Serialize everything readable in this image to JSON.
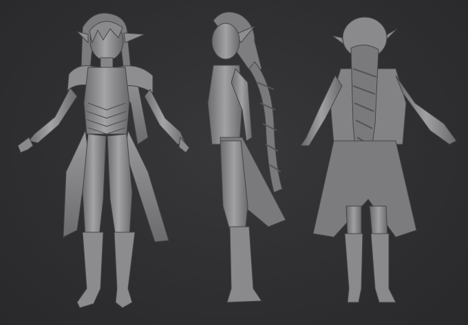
{
  "scene": {
    "background": "#2e2e30",
    "material": {
      "base": "#8a8a8c",
      "light": "#a9a9ab",
      "shadow": "#5a5a5c",
      "outline": "#3c3c3e"
    },
    "views": [
      {
        "id": "front",
        "icon": "elf-character-front-view"
      },
      {
        "id": "side",
        "icon": "elf-character-side-view"
      },
      {
        "id": "back",
        "icon": "elf-character-back-view"
      }
    ]
  }
}
